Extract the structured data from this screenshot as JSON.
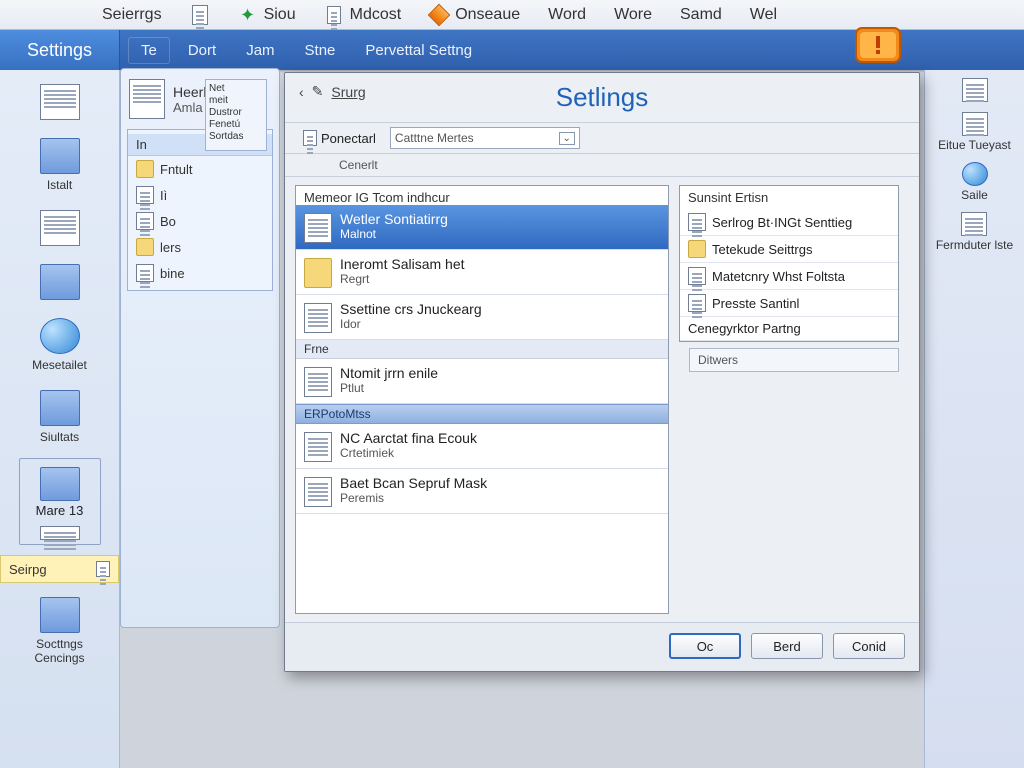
{
  "top_menu": {
    "items": [
      "Seierrgs",
      "Siou",
      "Mdcost",
      "Onseaue",
      "Word",
      "Wore",
      "Samd",
      "Wel"
    ]
  },
  "blue_bar": {
    "settings_label": "Settings",
    "items": [
      "Te",
      "Dort",
      "Jam",
      "Stne",
      "Pervettal Settng"
    ]
  },
  "left_strip": {
    "buttons": [
      {
        "label": "Istalt"
      },
      {
        "label": "Mesetailet"
      },
      {
        "label": "Siultats"
      }
    ],
    "group_button": {
      "label": "Mare 13"
    },
    "settings_btn": "Seirpg",
    "bottom_button": {
      "label": "Socttngs Cencings",
      "sub": ""
    }
  },
  "nav_panel": {
    "head_label": "Heerlt",
    "head_sub": "Amla",
    "side_block": {
      "header": "In",
      "rows": [
        "Fntult",
        "Iì",
        "Bo",
        "lers",
        "bine"
      ]
    },
    "mini_labels": [
      "Net",
      "meit",
      "Dustror",
      "Fenetú",
      "Sortdas"
    ]
  },
  "right_strip": {
    "rows": [
      {
        "label": ""
      },
      {
        "label": "Eitue Tueyast"
      },
      {
        "label": "Saile"
      },
      {
        "label": "Fermduter lste"
      }
    ]
  },
  "dialog": {
    "title": "Setlings",
    "crumbs_seg": "Srurg",
    "toolbar": {
      "btn1": "Ponectarl",
      "combo": "Catttne Mertes",
      "sub": "Cenerlt"
    },
    "left_list": {
      "group1_title": "Memeor IG Tcom indhcur",
      "items1": [
        {
          "title": "Wetler Sontiatirrg",
          "sub": "Malnot",
          "selected": true
        }
      ],
      "items2": [
        {
          "title": "Ineromt Salisam het",
          "sub": "Regrt"
        },
        {
          "title": "Ssettine crs Jnuckearg",
          "sub": "Idor"
        }
      ],
      "section_label": "Frne",
      "items3": [
        {
          "title": "Ntomit jrrn enile",
          "sub": "Ptlut"
        }
      ],
      "divider_label": "ERPotoMtss",
      "items4": [
        {
          "title": "NC Aarctat fina Ecouk",
          "sub": "Crtetimiek"
        },
        {
          "title": "Baet Bcan Sepruf Mask",
          "sub": "Peremis"
        }
      ]
    },
    "right_list": {
      "caption": "Sunsint Ertisn",
      "items": [
        {
          "label": "Serlrog Bt·INGt Senttieg"
        },
        {
          "label": "Tetekude Seittrgs"
        },
        {
          "label": "Matetcnry Whst Foltsta"
        },
        {
          "label": "Presste Santinl"
        },
        {
          "label": "Cenegyrktor Partng"
        }
      ]
    },
    "detail_label": "Ditwers",
    "buttons": {
      "ok": "Oc",
      "save": "Berd",
      "cancel": "Conid"
    }
  }
}
